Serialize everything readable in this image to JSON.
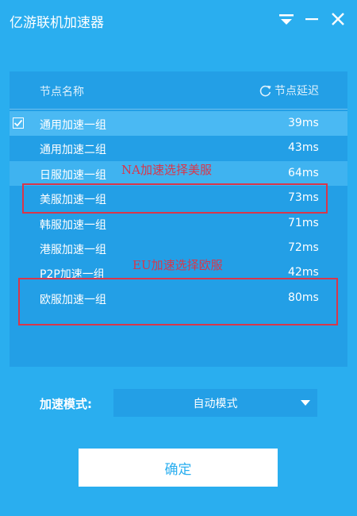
{
  "window": {
    "title": "亿游联机加速器",
    "controls": [
      "menu-icon",
      "minimize-icon",
      "close-icon"
    ]
  },
  "node_list": {
    "header_name": "节点名称",
    "header_refresh": "节点延迟",
    "rows": [
      {
        "name": "通用加速一组",
        "ping": "39ms",
        "selected": true
      },
      {
        "name": "通用加速二组",
        "ping": "43ms"
      },
      {
        "name": "日服加速一组",
        "ping": "64ms",
        "highlighted": true
      },
      {
        "name": "美服加速一组",
        "ping": "73ms"
      },
      {
        "name": "韩服加速一组",
        "ping": "71ms"
      },
      {
        "name": "港服加速一组",
        "ping": "72ms"
      },
      {
        "name": "P2P加速一组",
        "ping": "42ms"
      },
      {
        "name": "欧服加速一组",
        "ping": "80ms"
      }
    ]
  },
  "annotations": {
    "na_note": "NA加速选择美服",
    "eu_note": "EU加速选择欧服",
    "color": "#d9364a"
  },
  "mode": {
    "label": "加速模式:",
    "value": "自动模式"
  },
  "confirm_label": "确定",
  "colors": {
    "background": "#2aaeef",
    "panel": "#239fe6",
    "selected_row": "#4ab9f3",
    "button_text": "#2aaeef"
  }
}
